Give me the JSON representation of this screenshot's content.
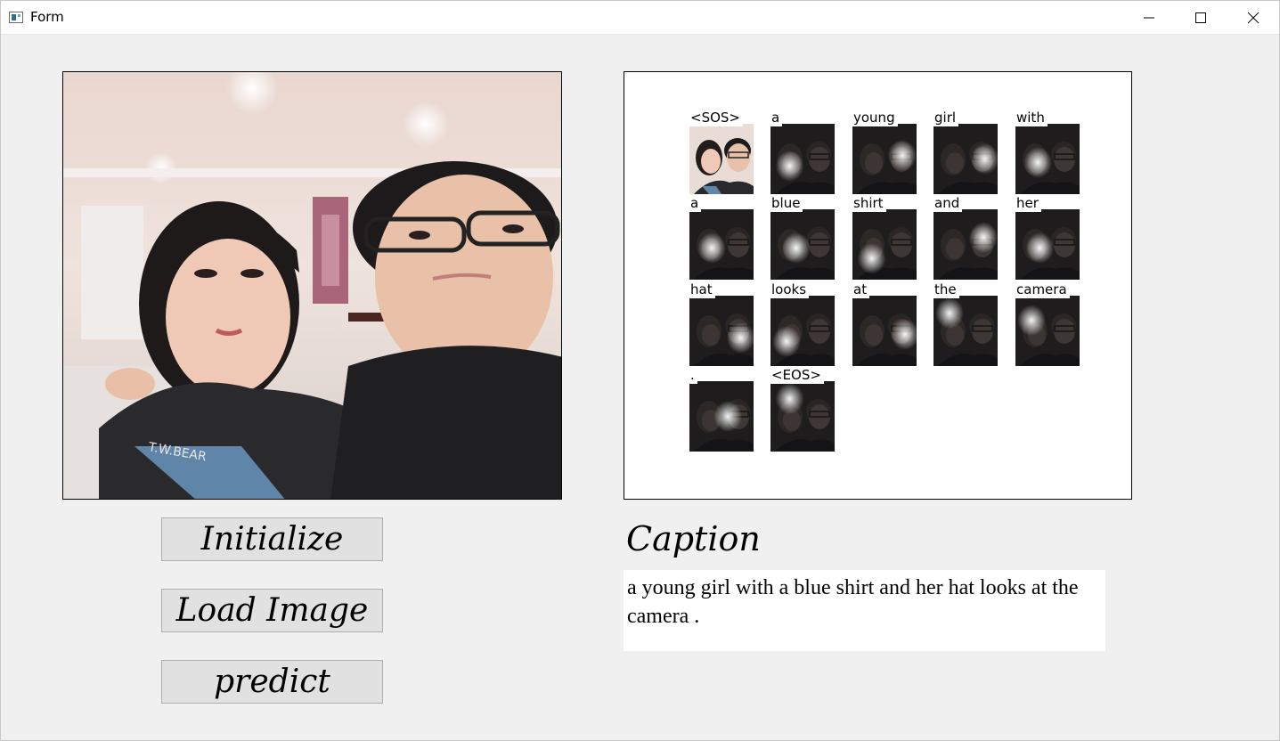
{
  "window": {
    "title": "Form",
    "app_icon": "form-app-icon",
    "controls": {
      "minimize": "minimize-icon",
      "maximize": "maximize-icon",
      "close": "close-icon"
    }
  },
  "buttons": {
    "initialize": "Initialize",
    "load_image": "Load Image",
    "predict": "predict"
  },
  "caption": {
    "label": "Caption",
    "text": "a young girl with a blue shirt and her hat looks at the camera ."
  },
  "attention": {
    "tokens": [
      "<SOS>",
      "a",
      "young",
      "girl",
      "with",
      "a",
      "blue",
      "shirt",
      "and",
      "her",
      "hat",
      "looks",
      "at",
      "the",
      "camera",
      ".",
      "<EOS>"
    ]
  }
}
